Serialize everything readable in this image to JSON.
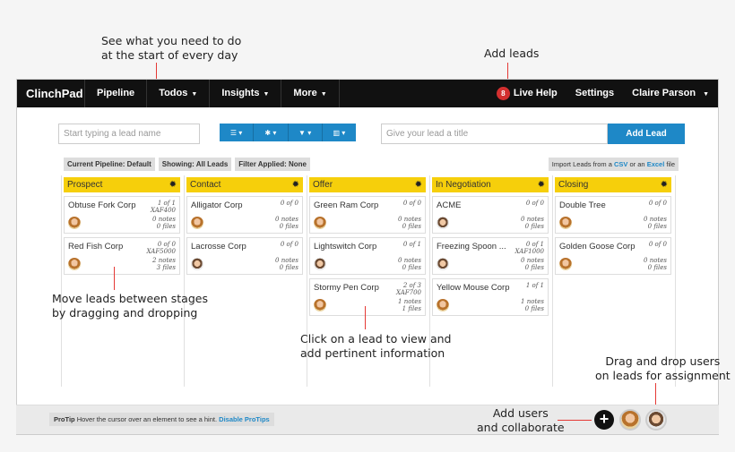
{
  "annotations": {
    "todos_line1": "See what you need to do",
    "todos_line2": "at the start of every day",
    "add_leads": "Add leads",
    "move_line1": "Move leads between stages",
    "move_line2": "by dragging and dropping",
    "click_line1": "Click on a lead to view and",
    "click_line2": "add pertinent information",
    "drag_line1": "Drag and drop users",
    "drag_line2": "on leads for assignment",
    "users_line1": "Add users",
    "users_line2": "and collaborate"
  },
  "navbar": {
    "brand": "ClinchPad",
    "pipeline": "Pipeline",
    "todos": "Todos",
    "insights": "Insights",
    "more": "More",
    "notification_count": "8",
    "live_help": "Live Help",
    "settings": "Settings",
    "user": "Claire Parson"
  },
  "controls": {
    "search_placeholder": "Start typing a lead name",
    "title_placeholder": "Give your lead a title",
    "add_lead_label": "Add Lead",
    "filter_icons": [
      "list-icon",
      "gear-icon",
      "filter-icon",
      "columns-icon"
    ]
  },
  "filters": {
    "pipeline": "Current Pipeline: Default",
    "showing": "Showing: All Leads",
    "applied": "Filter Applied: None"
  },
  "import": {
    "prefix": "Import Leads from a",
    "csv": "CSV",
    "or": "or an",
    "excel": "Excel",
    "suffix": "file"
  },
  "columns": [
    {
      "name": "Prospect",
      "cards": [
        {
          "name": "Obtuse Fork Corp",
          "count": "1 of 1",
          "value": "XAF400",
          "notes": "0 notes",
          "files": "0 files",
          "avatar": "female"
        },
        {
          "name": "Red Fish Corp",
          "count": "0 of 0",
          "value": "XAF5000",
          "notes": "2 notes",
          "files": "3 files",
          "avatar": "female"
        }
      ]
    },
    {
      "name": "Contact",
      "cards": [
        {
          "name": "Alligator Corp",
          "count": "0 of 0",
          "value": "",
          "notes": "0 notes",
          "files": "0 files",
          "avatar": "female"
        },
        {
          "name": "Lacrosse Corp",
          "count": "0 of 0",
          "value": "",
          "notes": "0 notes",
          "files": "0 files",
          "avatar": "male"
        }
      ]
    },
    {
      "name": "Offer",
      "cards": [
        {
          "name": "Green Ram Corp",
          "count": "0 of 0",
          "value": "",
          "notes": "0 notes",
          "files": "0 files",
          "avatar": "female"
        },
        {
          "name": "Lightswitch Corp",
          "count": "0 of 1",
          "value": "",
          "notes": "0 notes",
          "files": "0 files",
          "avatar": "male"
        },
        {
          "name": "Stormy Pen Corp",
          "count": "2 of 3",
          "value": "XAF700",
          "notes": "1 notes",
          "files": "1 files",
          "avatar": "female"
        }
      ]
    },
    {
      "name": "In Negotiation",
      "cards": [
        {
          "name": "ACME",
          "count": "0 of 0",
          "value": "",
          "notes": "0 notes",
          "files": "0 files",
          "avatar": "male"
        },
        {
          "name": "Freezing Spoon ...",
          "count": "0 of 1",
          "value": "XAF1000",
          "notes": "0 notes",
          "files": "0 files",
          "avatar": "male"
        },
        {
          "name": "Yellow Mouse Corp",
          "count": "1 of 1",
          "value": "",
          "notes": "1 notes",
          "files": "0 files",
          "avatar": "female"
        }
      ]
    },
    {
      "name": "Closing",
      "cards": [
        {
          "name": "Double Tree",
          "count": "0 of 0",
          "value": "",
          "notes": "0 notes",
          "files": "0 files",
          "avatar": "female"
        },
        {
          "name": "Golden Goose Corp",
          "count": "0 of 0",
          "value": "",
          "notes": "0 notes",
          "files": "0 files",
          "avatar": "female"
        }
      ]
    }
  ],
  "protip": {
    "label": "ProTip",
    "text": "Hover the cursor over an element to see a hint.",
    "link": "Disable ProTips"
  },
  "colors": {
    "navbar": "#111111",
    "accent": "#1e88c7",
    "stage_header": "#f6cf0b",
    "annotation_line": "#e53935"
  }
}
